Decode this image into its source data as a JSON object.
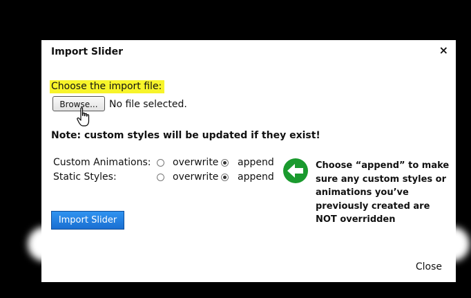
{
  "dialog": {
    "title": "Import Slider",
    "close_x": "×",
    "choose_label": "Choose the import file:",
    "browse_label": "Browse...",
    "file_status": "No file selected.",
    "note": "Note: custom styles will be updated if they exist!",
    "options": [
      {
        "label": "Custom Animations:",
        "overwrite": "overwrite",
        "append": "append",
        "selected": "append"
      },
      {
        "label": "Static Styles:",
        "overwrite": "overwrite",
        "append": "append",
        "selected": "append"
      }
    ],
    "hint": "Choose “append” to make sure any custom styles or animations you’ve previously created are NOT overridden",
    "import_button": "Import Slider",
    "close_link": "Close"
  },
  "colors": {
    "highlight": "#f7f42a",
    "import_button": "#1f7fe0",
    "arrow_green": "#1a9a2e",
    "backdrop": "#000000"
  },
  "icons": [
    "close-icon",
    "hand-cursor-icon",
    "left-arrow-icon"
  ]
}
